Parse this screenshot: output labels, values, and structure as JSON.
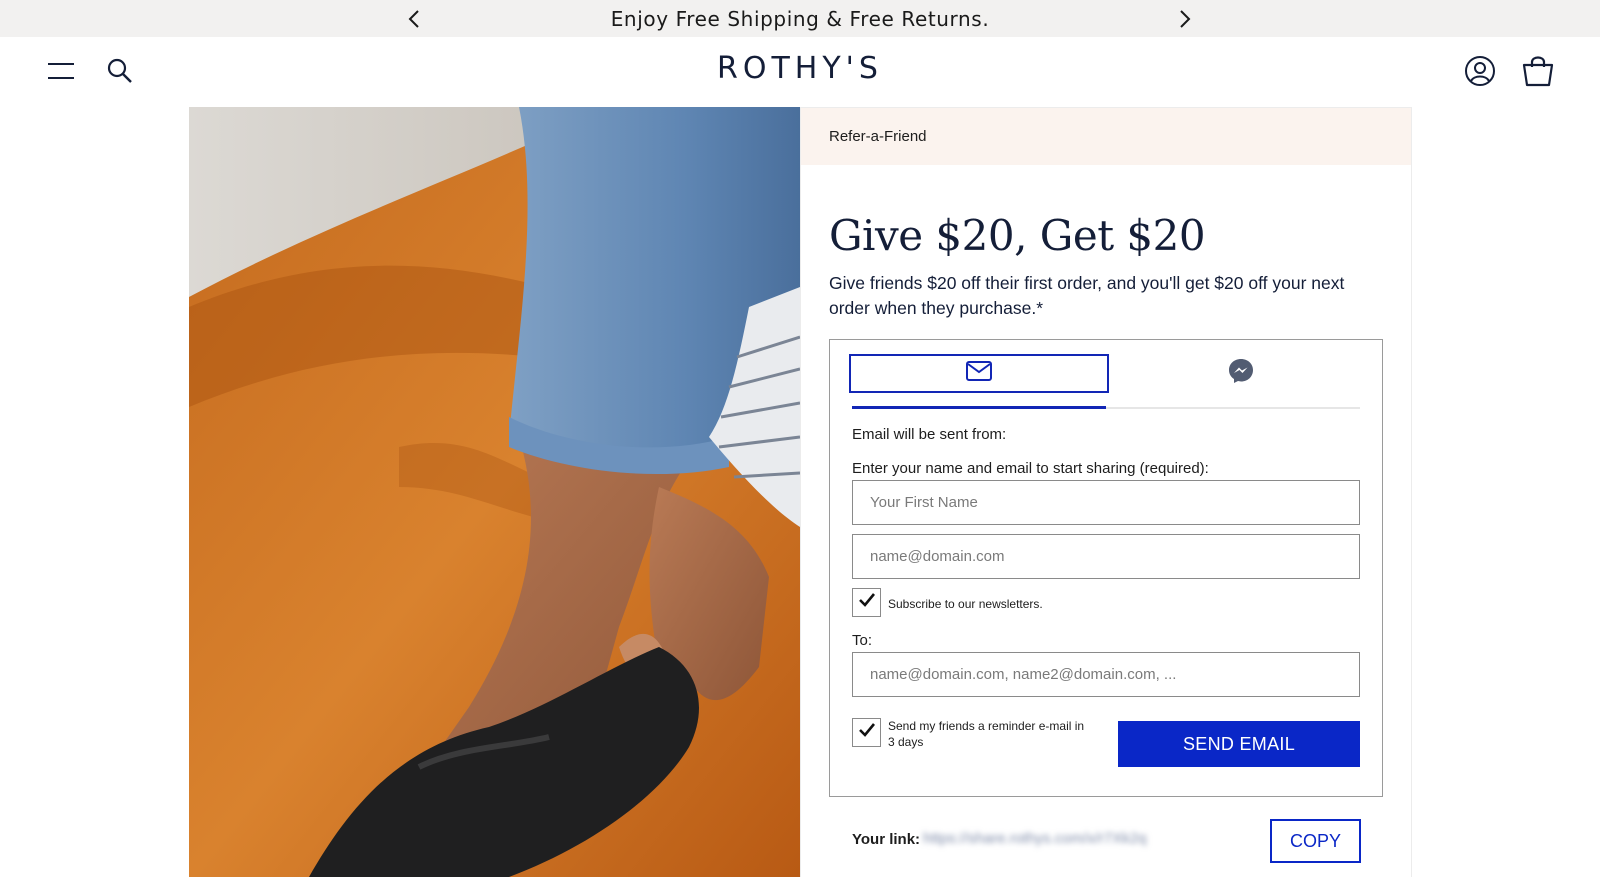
{
  "announcement": {
    "text": "Enjoy Free Shipping & Free Returns."
  },
  "header": {
    "logo": "ROTHY'S"
  },
  "icons": {
    "prev": "chevron-left-icon",
    "next": "chevron-right-icon",
    "menu": "hamburger-menu-icon",
    "search": "search-icon",
    "account": "account-icon",
    "bag": "shopping-bag-icon",
    "email_tab": "envelope-icon",
    "messenger_tab": "messenger-icon",
    "check": "checkmark-icon"
  },
  "referral": {
    "bar_label": "Refer-a-Friend",
    "title": "Give $20, Get $20",
    "subtitle": "Give friends $20 off their first order, and you'll get $20 off your next order when they purchase.*",
    "sent_from_label": "Email will be sent from:",
    "enter_label": "Enter your name and email to start sharing (required):",
    "first_name_placeholder": "Your First Name",
    "email_placeholder": "name@domain.com",
    "subscribe_label": "Subscribe to our newsletters.",
    "subscribe_checked": true,
    "to_label": "To:",
    "to_placeholder": "name@domain.com, name2@domain.com, ...",
    "reminder_label": "Send my friends a reminder e-mail in 3 days",
    "reminder_checked": true,
    "send_button": "SEND EMAIL",
    "your_link_label": "Your link:",
    "your_link_value": "https://share.rothys.com/x/r7Xk2q",
    "copy_button": "COPY"
  },
  "colors": {
    "accent": "#0a27c7",
    "bar_bg": "#fbf3ee",
    "announce_bg": "#f2f1f0",
    "text": "#141e38"
  }
}
